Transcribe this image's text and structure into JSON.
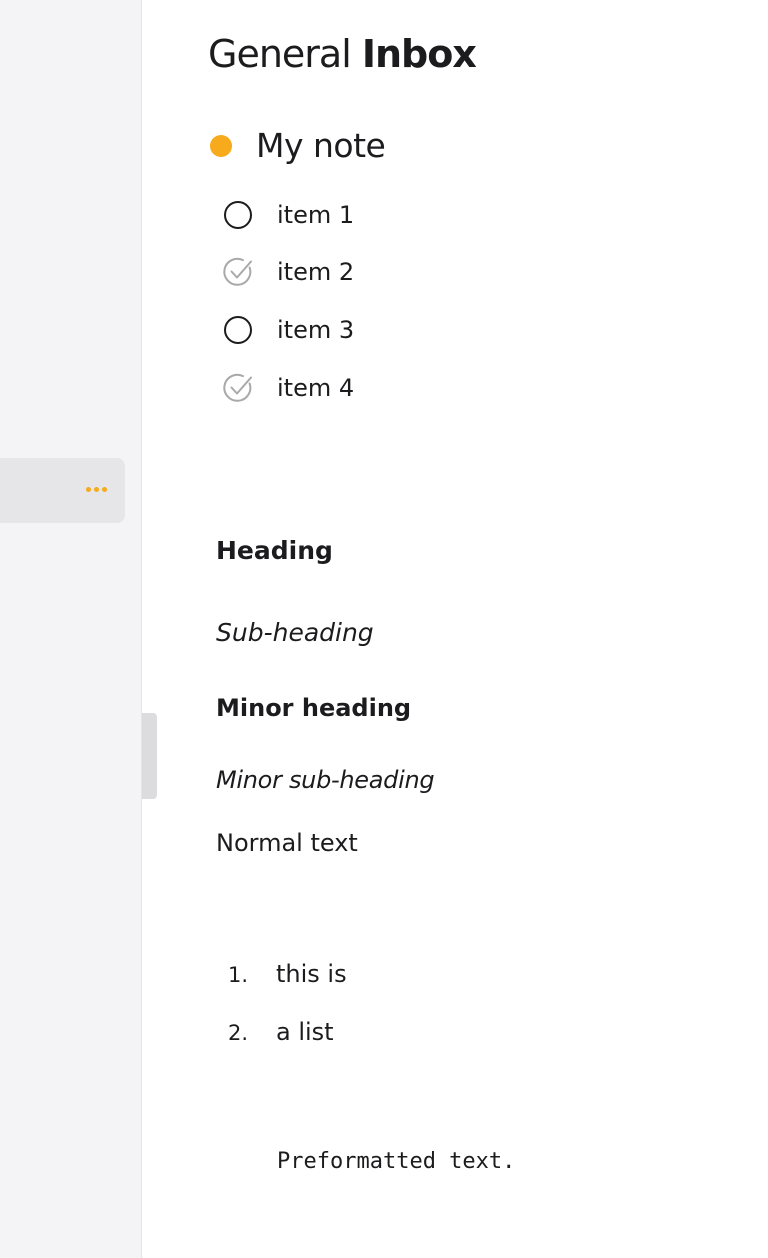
{
  "title": {
    "light": "General",
    "bold": "Inbox"
  },
  "note": {
    "title": "My note",
    "accent_color": "#f7aa1b",
    "checklist": [
      {
        "label": "item 1",
        "checked": false
      },
      {
        "label": "item 2",
        "checked": true
      },
      {
        "label": "item 3",
        "checked": false
      },
      {
        "label": "item 4",
        "checked": true
      }
    ],
    "heading": "Heading",
    "subheading": "Sub-heading",
    "minor_heading": "Minor heading",
    "minor_subheading": "Minor sub-heading",
    "normal_text": "Normal text",
    "ordered_list": [
      {
        "num": "1.",
        "text": "this is"
      },
      {
        "num": "2.",
        "text": "a list"
      }
    ],
    "preformatted": "Preformatted text."
  },
  "sidebar": {
    "selected_row_action_icon": "more-horizontal-icon"
  }
}
